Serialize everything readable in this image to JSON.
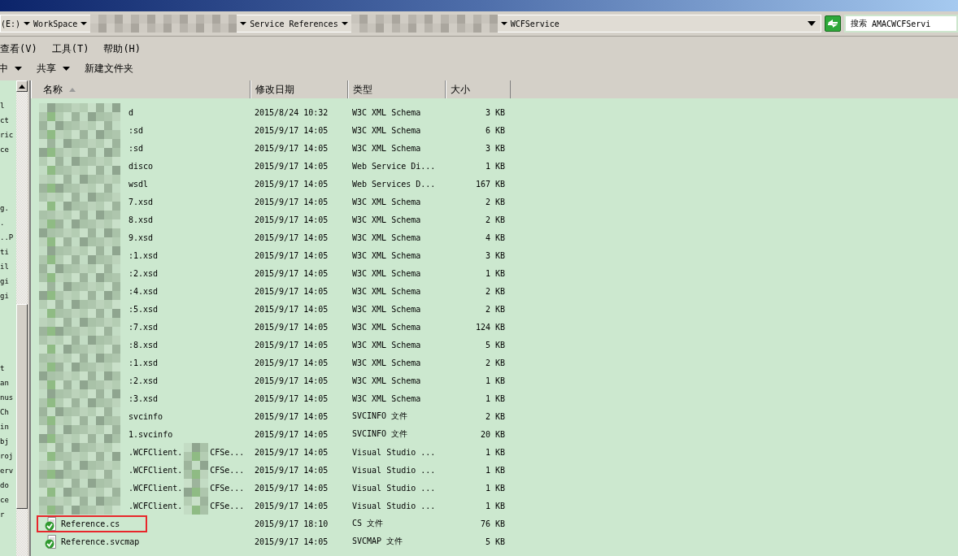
{
  "address_bar": {
    "crumbs": [
      {
        "text": "(E:)",
        "kind": "text"
      },
      {
        "text": "WorkSpace",
        "kind": "text"
      },
      {
        "kind": "blurred"
      },
      {
        "text": "Service References",
        "kind": "text"
      },
      {
        "kind": "blurred"
      },
      {
        "text": "WCFService",
        "kind": "text"
      }
    ],
    "search": {
      "label": "搜索",
      "value": "AMACWCFServi"
    }
  },
  "menu": [
    "查看(V)",
    "工具(T)",
    "帮助(H)"
  ],
  "toolbar": [
    {
      "label": "中",
      "dropdown": true
    },
    {
      "label": "共享",
      "dropdown": true
    },
    {
      "label": "新建文件夹",
      "dropdown": false
    }
  ],
  "left_pane": {
    "groups": [
      [
        "l",
        "ct",
        "ric",
        "ce"
      ],
      [
        "g.",
        ".",
        "..P",
        "ti",
        "il",
        "gi",
        "gi"
      ],
      [
        "t",
        "an",
        "nus",
        "Ch",
        "in",
        "bj",
        "roj",
        "erv",
        "do",
        "ce",
        "r"
      ]
    ]
  },
  "columns": [
    {
      "label": "名称",
      "sorted": true
    },
    {
      "label": "修改日期",
      "sorted": false
    },
    {
      "label": "类型",
      "sorted": false
    },
    {
      "label": "大小",
      "sorted": false
    }
  ],
  "rows": [
    {
      "kind": "blurred",
      "name": "d",
      "date": "2015/8/24 10:32",
      "type": "W3C XML Schema",
      "size": "3 KB",
      "highlighted": false
    },
    {
      "kind": "blurred",
      "name": ":sd",
      "date": "2015/9/17 14:05",
      "type": "W3C XML Schema",
      "size": "6 KB",
      "highlighted": false
    },
    {
      "kind": "blurred",
      "name": ":sd",
      "date": "2015/9/17 14:05",
      "type": "W3C XML Schema",
      "size": "3 KB",
      "highlighted": false
    },
    {
      "kind": "blurred",
      "name": "disco",
      "date": "2015/9/17 14:05",
      "type": "Web Service Di...",
      "size": "1 KB",
      "highlighted": false
    },
    {
      "kind": "blurred",
      "name": "wsdl",
      "date": "2015/9/17 14:05",
      "type": "Web Services D...",
      "size": "167 KB",
      "highlighted": false
    },
    {
      "kind": "blurred",
      "name": "7.xsd",
      "date": "2015/9/17 14:05",
      "type": "W3C XML Schema",
      "size": "2 KB",
      "highlighted": false
    },
    {
      "kind": "blurred",
      "name": "8.xsd",
      "date": "2015/9/17 14:05",
      "type": "W3C XML Schema",
      "size": "2 KB",
      "highlighted": false
    },
    {
      "kind": "blurred",
      "name": "9.xsd",
      "date": "2015/9/17 14:05",
      "type": "W3C XML Schema",
      "size": "4 KB",
      "highlighted": false
    },
    {
      "kind": "blurred",
      "name": ":1.xsd",
      "date": "2015/9/17 14:05",
      "type": "W3C XML Schema",
      "size": "3 KB",
      "highlighted": false
    },
    {
      "kind": "blurred",
      "name": ":2.xsd",
      "date": "2015/9/17 14:05",
      "type": "W3C XML Schema",
      "size": "1 KB",
      "highlighted": false
    },
    {
      "kind": "blurred",
      "name": ":4.xsd",
      "date": "2015/9/17 14:05",
      "type": "W3C XML Schema",
      "size": "2 KB",
      "highlighted": false
    },
    {
      "kind": "blurred",
      "name": ":5.xsd",
      "date": "2015/9/17 14:05",
      "type": "W3C XML Schema",
      "size": "2 KB",
      "highlighted": false
    },
    {
      "kind": "blurred",
      "name": ":7.xsd",
      "date": "2015/9/17 14:05",
      "type": "W3C XML Schema",
      "size": "124 KB",
      "highlighted": false
    },
    {
      "kind": "blurred",
      "name": ":8.xsd",
      "date": "2015/9/17 14:05",
      "type": "W3C XML Schema",
      "size": "5 KB",
      "highlighted": false
    },
    {
      "kind": "blurred",
      "name": ":1.xsd",
      "date": "2015/9/17 14:05",
      "type": "W3C XML Schema",
      "size": "2 KB",
      "highlighted": false
    },
    {
      "kind": "blurred",
      "name": ":2.xsd",
      "date": "2015/9/17 14:05",
      "type": "W3C XML Schema",
      "size": "1 KB",
      "highlighted": false
    },
    {
      "kind": "blurred",
      "name": ":3.xsd",
      "date": "2015/9/17 14:05",
      "type": "W3C XML Schema",
      "size": "1 KB",
      "highlighted": false
    },
    {
      "kind": "blurred",
      "name": "svcinfo",
      "date": "2015/9/17 14:05",
      "type": "SVCINFO 文件",
      "size": "2 KB",
      "highlighted": false
    },
    {
      "kind": "blurred",
      "name": "1.svcinfo",
      "date": "2015/9/17 14:05",
      "type": "SVCINFO 文件",
      "size": "20 KB",
      "highlighted": false
    },
    {
      "kind": "blurred",
      "name": ".WCFClient.",
      "name_tail": "CFSe...",
      "date": "2015/9/17 14:05",
      "type": "Visual Studio ...",
      "size": "1 KB",
      "highlighted": false
    },
    {
      "kind": "blurred",
      "name": ".WCFClient.",
      "name_tail": "CFSe...",
      "date": "2015/9/17 14:05",
      "type": "Visual Studio ...",
      "size": "1 KB",
      "highlighted": false
    },
    {
      "kind": "blurred",
      "name": ".WCFClient.",
      "name_tail": "CFSe...",
      "date": "2015/9/17 14:05",
      "type": "Visual Studio ...",
      "size": "1 KB",
      "highlighted": false
    },
    {
      "kind": "blurred",
      "name": ".WCFClient.",
      "name_tail": "CFSe...",
      "date": "2015/9/17 14:05",
      "type": "Visual Studio ...",
      "size": "1 KB",
      "highlighted": false
    },
    {
      "kind": "file",
      "name": "Reference.cs",
      "date": "2015/9/17 18:10",
      "type": "CS 文件",
      "size": "76 KB",
      "highlighted": true
    },
    {
      "kind": "file",
      "name": "Reference.svcmap",
      "date": "2015/9/17 14:05",
      "type": "SVCMAP 文件",
      "size": "5 KB",
      "highlighted": false
    }
  ]
}
